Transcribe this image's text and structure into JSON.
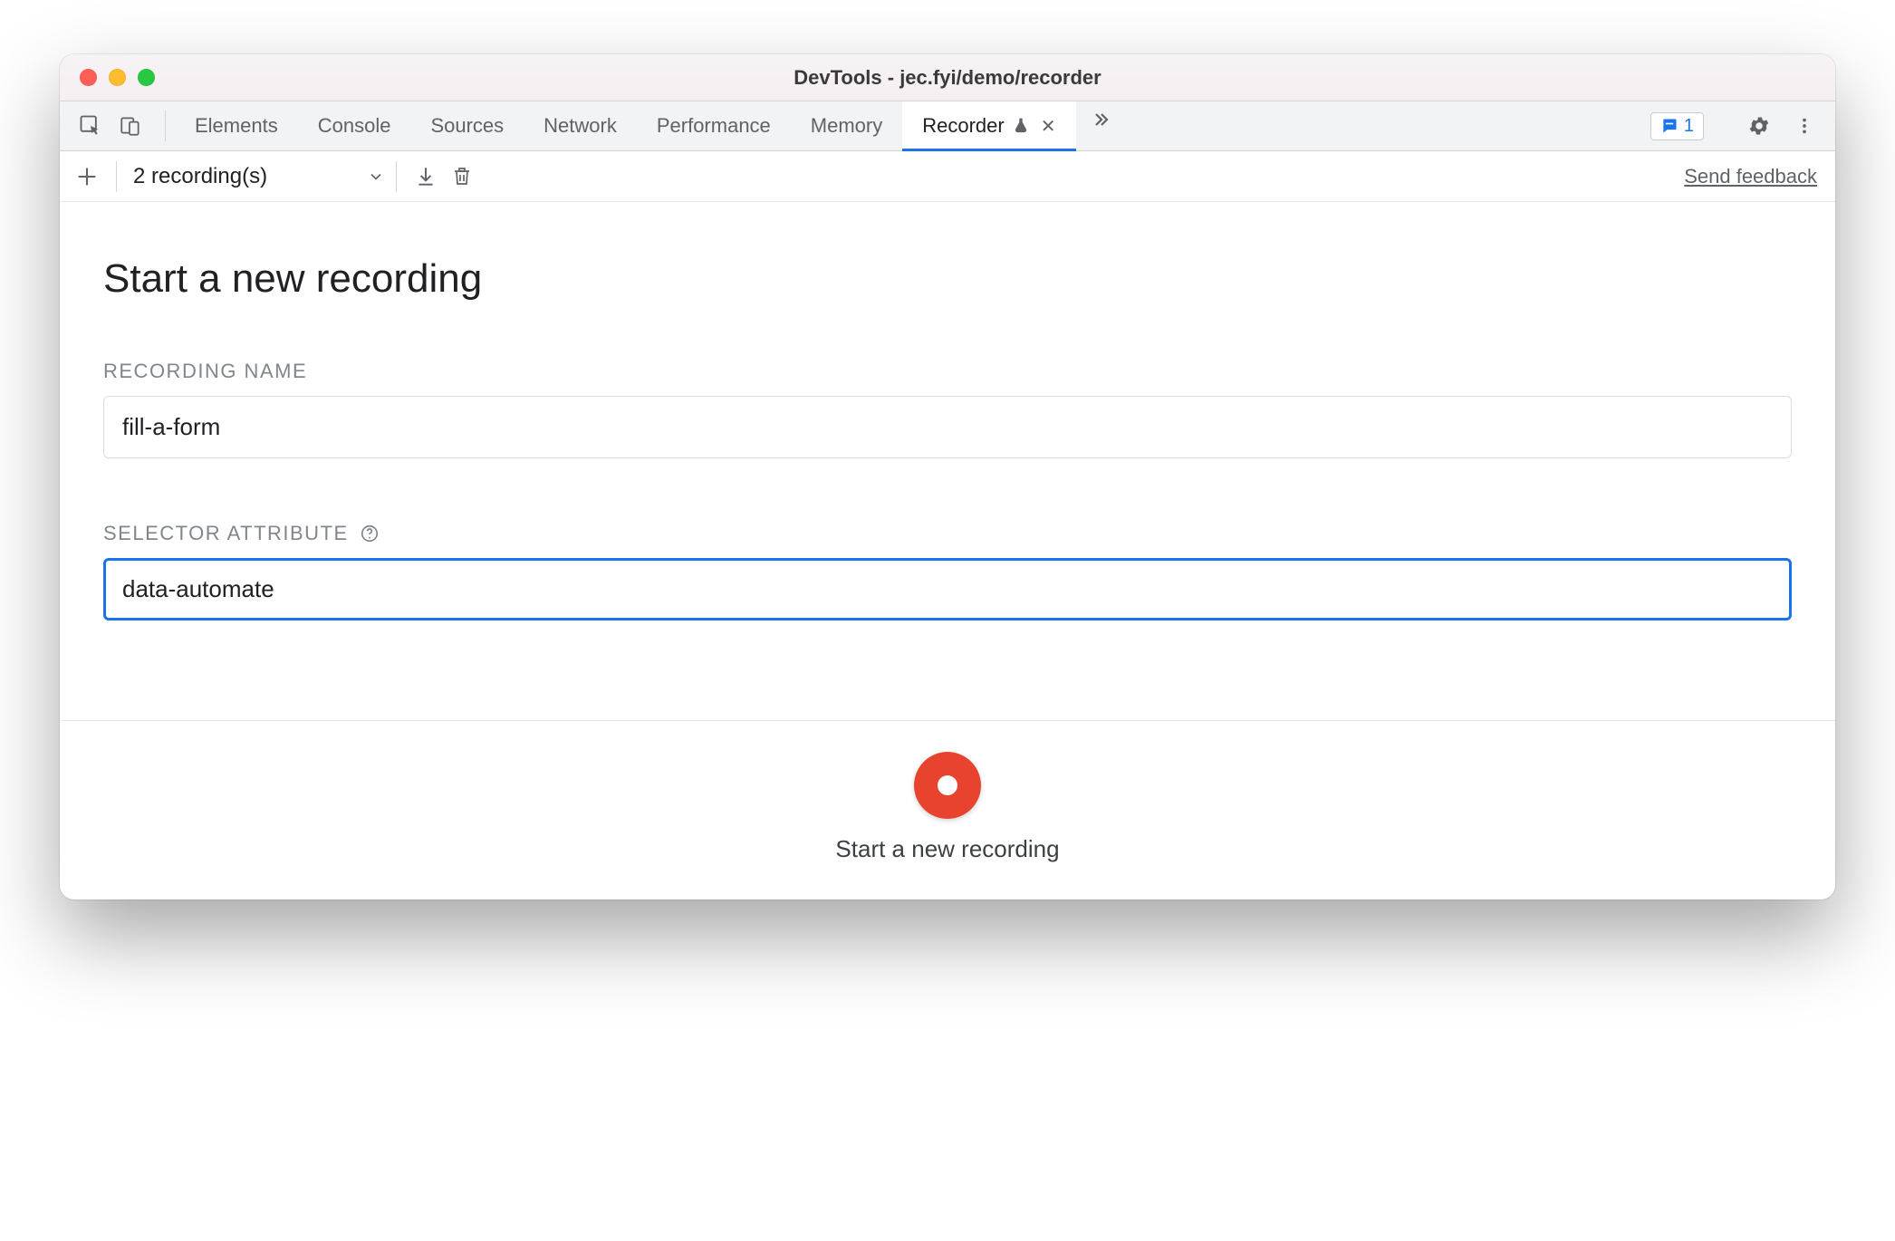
{
  "window": {
    "title": "DevTools - jec.fyi/demo/recorder"
  },
  "tabs": {
    "items": [
      {
        "label": "Elements"
      },
      {
        "label": "Console"
      },
      {
        "label": "Sources"
      },
      {
        "label": "Network"
      },
      {
        "label": "Performance"
      },
      {
        "label": "Memory"
      },
      {
        "label": "Recorder",
        "active": true,
        "experimental": true,
        "closable": true
      }
    ],
    "issues_count": "1"
  },
  "subbar": {
    "recordings_label": "2 recording(s)",
    "feedback_label": "Send feedback"
  },
  "main": {
    "page_title": "Start a new recording",
    "recording_name_label": "RECORDING NAME",
    "recording_name_value": "fill-a-form",
    "selector_attr_label": "SELECTOR ATTRIBUTE",
    "selector_attr_value": "data-automate"
  },
  "footer": {
    "record_label": "Start a new recording"
  }
}
